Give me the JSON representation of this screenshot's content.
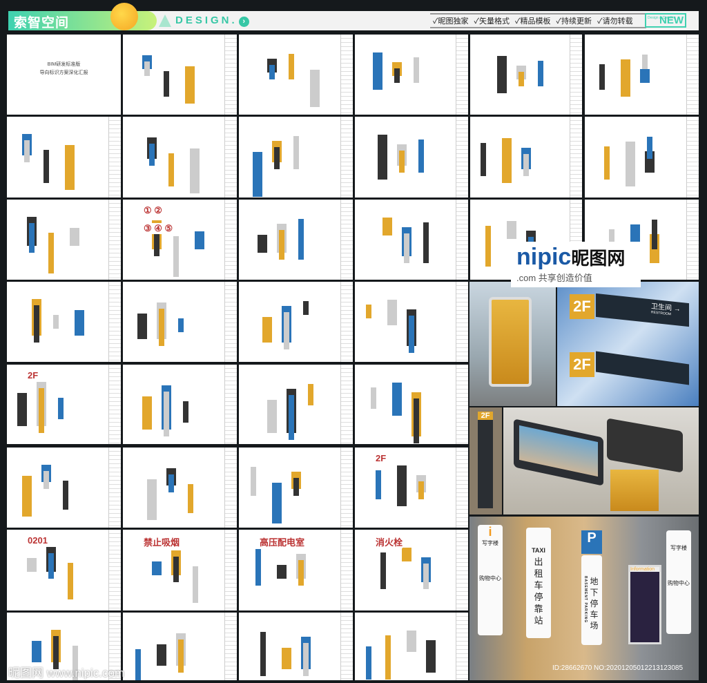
{
  "header": {
    "logo": "索智空间",
    "design": "DESIGN.",
    "arrow": "›",
    "tags": [
      "✓昵图独家",
      "✓矢量格式",
      "✓精品模板",
      "✓持续更新",
      "✓请勿转载"
    ],
    "new_badge": "NEW",
    "new_small": "Design & Creative"
  },
  "cover": {
    "title1": "BIM研发标准版",
    "title2": "导向标识方案深化汇报"
  },
  "thumb_labels": {
    "circles": "① ②",
    "circles2": "③ ④ ⑤",
    "floor": "2F",
    "room": "0201",
    "nosmoke": "禁止吸烟",
    "fire": "消火栓",
    "highvolt": "高压配电室"
  },
  "watermark": {
    "brand": "nipic",
    "cn": "昵图网",
    "dotcom": ".com",
    "slogan": "共享创造价值"
  },
  "signs": {
    "floor": "2F",
    "restroom": "卫生间",
    "restroom_en": "RESTROOM",
    "taxi": "TAXI",
    "taxi_cn": "出租车停靠站",
    "parking": "P",
    "parking_cn": "地下停车场",
    "parking_en": "BASEMENT PARKING",
    "info": "i",
    "information": "Information",
    "office": "写字楼",
    "shopping": "购物中心"
  },
  "footer": {
    "watermark": "昵图网 www.nipic.com",
    "id": "ID:28662670 NO:20201205012213123085"
  }
}
